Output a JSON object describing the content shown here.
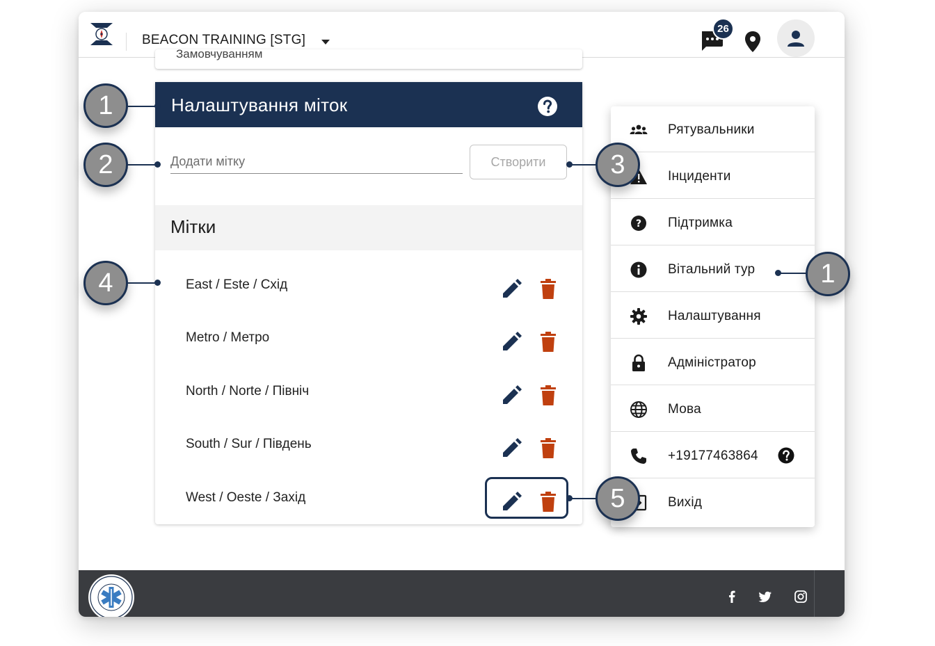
{
  "header": {
    "app_title": "BEACON TRAINING [STG]",
    "chat_badge_count": "26"
  },
  "previous_card": {
    "text": "Замовчуванням"
  },
  "settings_card": {
    "title": "Налаштування міток",
    "add_tag_placeholder": "Додати мітку",
    "create_label": "Створити",
    "tags_heading": "Мітки",
    "tags": [
      {
        "label": "East / Este / Схід"
      },
      {
        "label": "Metro /  Метро"
      },
      {
        "label": "North / Norte / Північ"
      },
      {
        "label": "South / Sur / Південь"
      },
      {
        "label": "West / Oeste / Захід"
      }
    ]
  },
  "menu": {
    "items": [
      {
        "label": "Рятувальники",
        "icon": "group-icon"
      },
      {
        "label": "Інциденти",
        "icon": "warning-icon"
      },
      {
        "label": "Підтримка",
        "icon": "support-icon"
      },
      {
        "label": "Вітальний тур",
        "icon": "info-icon"
      },
      {
        "label": "Налаштування",
        "icon": "gear-icon"
      },
      {
        "label": "Адміністратор",
        "icon": "lock-icon"
      },
      {
        "label": "Мова",
        "icon": "globe-icon"
      },
      {
        "label": "+19177463864",
        "icon": "phone-icon"
      },
      {
        "label": "Вихід",
        "icon": "logout-icon"
      }
    ]
  },
  "callouts": {
    "c1": "1",
    "c2": "2",
    "c3": "3",
    "c4": "4",
    "c5": "5",
    "c1_menu": "1"
  },
  "colors": {
    "navy": "#1b3152",
    "delete_red": "#c0400f",
    "footer_bg": "#3a3c40"
  }
}
